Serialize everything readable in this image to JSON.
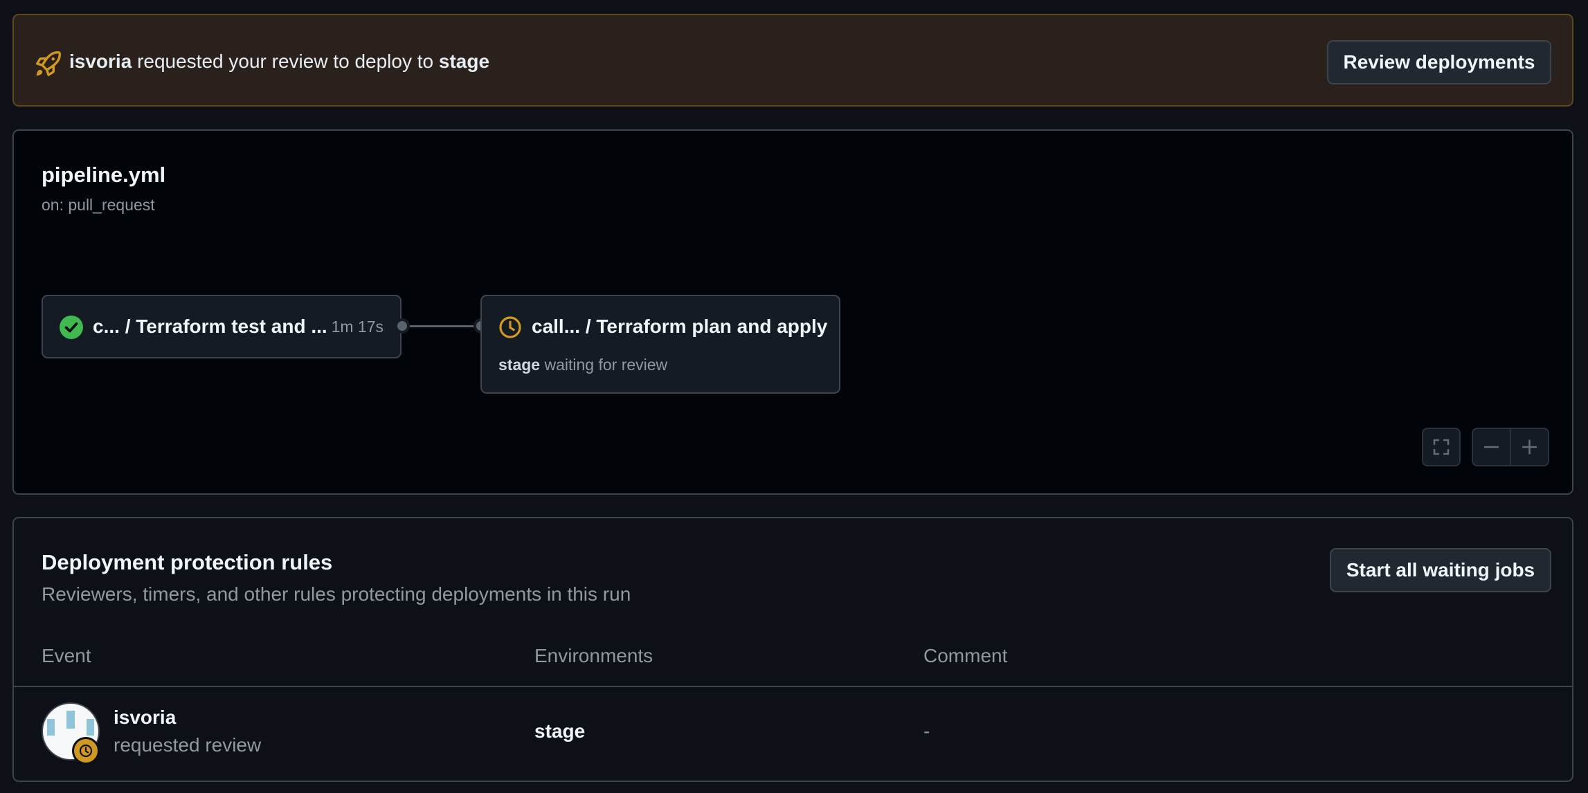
{
  "banner": {
    "icon": "rocket-icon",
    "user": "isvoria",
    "message": "requested your review to deploy to",
    "environment": "stage",
    "button_label": "Review deployments"
  },
  "workflow": {
    "title": "pipeline.yml",
    "trigger": "on: pull_request",
    "jobs": [
      {
        "name": "c... / Terraform test and ...",
        "duration": "1m 17s",
        "status": "success",
        "icon": "check-circle-icon"
      },
      {
        "name": "call... / Terraform plan and apply",
        "status": "waiting",
        "icon": "clock-icon",
        "env": "stage",
        "note": "waiting for review"
      }
    ],
    "controls": [
      "fullscreen-icon",
      "zoom-out-icon",
      "zoom-in-icon"
    ]
  },
  "rules": {
    "title": "Deployment protection rules",
    "description": "Reviewers, timers, and other rules protecting deployments in this run",
    "button_label": "Start all waiting jobs",
    "columns": [
      "Event",
      "Environments",
      "Comment"
    ],
    "rows": [
      {
        "user": "isvoria",
        "event": "requested review",
        "environment": "stage",
        "comment": "-"
      }
    ]
  },
  "colors": {
    "background": "#0d1117",
    "banner_bg": "#2b211c",
    "success": "#3fb950",
    "pending": "#d29922"
  }
}
